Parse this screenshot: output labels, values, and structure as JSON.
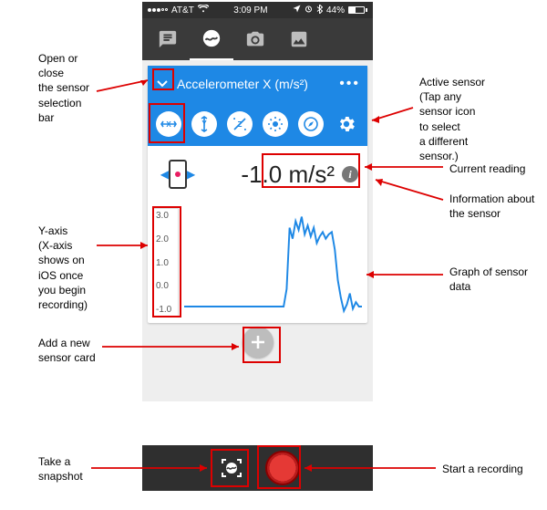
{
  "status": {
    "carrier": "AT&T",
    "time": "3:09 PM",
    "battery_pct": "44%"
  },
  "sensor": {
    "title": "Accelerometer X (m/s²)",
    "icons": [
      "X",
      "Y",
      "Z",
      "light",
      "compass",
      "gear"
    ]
  },
  "reading": {
    "value": "-1.0 m/s²"
  },
  "yaxis": [
    "3.0",
    "2.0",
    "1.0",
    "0.0",
    "-1.0"
  ],
  "annotations": {
    "open_close": "Open or\nclose\nthe sensor\nselection\nbar",
    "active_sensor": "Active sensor\n(Tap any\nsensor icon\nto select\na different\nsensor.)",
    "current_reading": "Current reading",
    "info": "Information about\nthe sensor",
    "yaxis": "Y-axis\n(X-axis\nshows on\niOS once\nyou begin\nrecording)",
    "graph": "Graph of sensor\ndata",
    "add_card": "Add a new\nsensor card",
    "snapshot": "Take a\nsnapshot",
    "record": "Start a recording"
  },
  "chart_data": {
    "type": "line",
    "title": "",
    "xlabel": "",
    "ylabel": "",
    "ylim": [
      -1.5,
      3.5
    ],
    "y_ticks": [
      3.0,
      2.0,
      1.0,
      0.0,
      -1.0
    ],
    "x": [
      0,
      1,
      2,
      3,
      4,
      5,
      6,
      7,
      8,
      9,
      10,
      11,
      12,
      13,
      14,
      15,
      16,
      17,
      18,
      19,
      20,
      21,
      22,
      23,
      24,
      25,
      26,
      27,
      28,
      29,
      30,
      31,
      32,
      33,
      34,
      35,
      36,
      37,
      38,
      39,
      40,
      41,
      42,
      43,
      44,
      45,
      46,
      47,
      48,
      49,
      50,
      51,
      52,
      53,
      54,
      55,
      56,
      57,
      58,
      59
    ],
    "values": [
      -1.0,
      -1.0,
      -1.0,
      -1.0,
      -1.0,
      -1.0,
      -1.0,
      -1.0,
      -1.0,
      -1.0,
      -1.0,
      -1.0,
      -1.0,
      -1.0,
      -1.0,
      -1.0,
      -1.0,
      -1.0,
      -1.0,
      -1.0,
      -1.0,
      -1.0,
      -1.0,
      -1.0,
      -1.0,
      -1.0,
      -1.0,
      -1.0,
      -1.0,
      -1.0,
      -1.0,
      -1.0,
      -1.0,
      -1.0,
      -0.2,
      2.6,
      2.1,
      2.9,
      2.5,
      3.1,
      2.3,
      2.7,
      2.2,
      2.6,
      1.9,
      2.2,
      2.4,
      2.1,
      2.3,
      2.4,
      1.6,
      0.2,
      -0.6,
      -1.2,
      -0.9,
      -0.4,
      -1.1,
      -0.8,
      -1.0,
      -1.0
    ]
  }
}
